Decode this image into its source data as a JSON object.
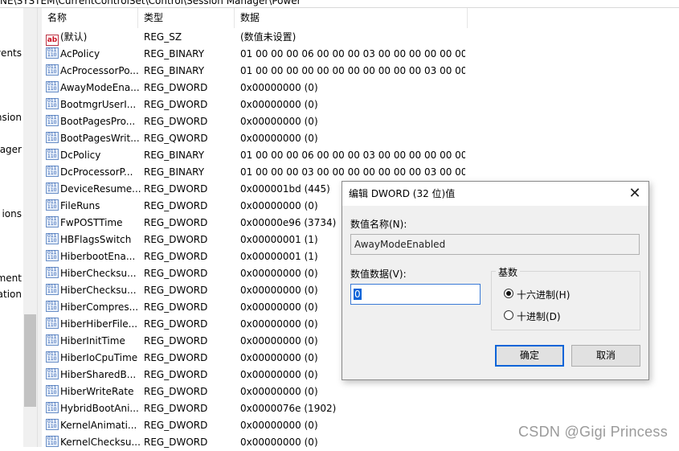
{
  "address": "NE\\SYSTEM\\CurrentControlSet\\Control\\Session Manager\\Power",
  "tree_items": [
    "vents",
    "nsion",
    "nager",
    "ions",
    "ment",
    "ation"
  ],
  "columns": {
    "name": "名称",
    "type": "类型",
    "data": "数据"
  },
  "rows": [
    {
      "icon": "string-icon",
      "name": "(默认)",
      "type": "REG_SZ",
      "data": "(数值未设置)"
    },
    {
      "icon": "binary-icon",
      "name": "AcPolicy",
      "type": "REG_BINARY",
      "data": "01 00 00 00 06 00 00 00 03 00 00 00 00 00 00..."
    },
    {
      "icon": "binary-icon",
      "name": "AcProcessorPo...",
      "type": "REG_BINARY",
      "data": "01 00 00 00 00 00 00 00 00 00 00 00 03 00 00..."
    },
    {
      "icon": "binary-icon",
      "name": "AwayModeEna...",
      "type": "REG_DWORD",
      "data": "0x00000000 (0)"
    },
    {
      "icon": "binary-icon",
      "name": "BootmgrUserI...",
      "type": "REG_DWORD",
      "data": "0x00000000 (0)"
    },
    {
      "icon": "binary-icon",
      "name": "BootPagesPro...",
      "type": "REG_DWORD",
      "data": "0x00000000 (0)"
    },
    {
      "icon": "binary-icon",
      "name": "BootPagesWrit...",
      "type": "REG_QWORD",
      "data": "0x00000000 (0)"
    },
    {
      "icon": "binary-icon",
      "name": "DcPolicy",
      "type": "REG_BINARY",
      "data": "01 00 00 00 06 00 00 00 03 00 00 00 00 00 00..."
    },
    {
      "icon": "binary-icon",
      "name": "DcProcessorP...",
      "type": "REG_BINARY",
      "data": "01 00 00 00 03 00 00 00 00 00 00 00 03 00 00..."
    },
    {
      "icon": "binary-icon",
      "name": "DeviceResume...",
      "type": "REG_DWORD",
      "data": "0x000001bd (445)"
    },
    {
      "icon": "binary-icon",
      "name": "FileRuns",
      "type": "REG_DWORD",
      "data": "0x00000000 (0)"
    },
    {
      "icon": "binary-icon",
      "name": "FwPOSTTime",
      "type": "REG_DWORD",
      "data": "0x00000e96 (3734)"
    },
    {
      "icon": "binary-icon",
      "name": "HBFlagsSwitch",
      "type": "REG_DWORD",
      "data": "0x00000001 (1)"
    },
    {
      "icon": "binary-icon",
      "name": "HiberbootEna...",
      "type": "REG_DWORD",
      "data": "0x00000001 (1)"
    },
    {
      "icon": "binary-icon",
      "name": "HiberChecksu...",
      "type": "REG_DWORD",
      "data": "0x00000000 (0)"
    },
    {
      "icon": "binary-icon",
      "name": "HiberChecksu...",
      "type": "REG_DWORD",
      "data": "0x00000000 (0)"
    },
    {
      "icon": "binary-icon",
      "name": "HiberCompres...",
      "type": "REG_DWORD",
      "data": "0x00000000 (0)"
    },
    {
      "icon": "binary-icon",
      "name": "HiberHiberFile...",
      "type": "REG_DWORD",
      "data": "0x00000000 (0)"
    },
    {
      "icon": "binary-icon",
      "name": "HiberInitTime",
      "type": "REG_DWORD",
      "data": "0x00000000 (0)"
    },
    {
      "icon": "binary-icon",
      "name": "HiberIoCpuTime",
      "type": "REG_DWORD",
      "data": "0x00000000 (0)"
    },
    {
      "icon": "binary-icon",
      "name": "HiberSharedB...",
      "type": "REG_DWORD",
      "data": "0x00000000 (0)"
    },
    {
      "icon": "binary-icon",
      "name": "HiberWriteRate",
      "type": "REG_DWORD",
      "data": "0x00000000 (0)"
    },
    {
      "icon": "binary-icon",
      "name": "HybridBootAni...",
      "type": "REG_DWORD",
      "data": "0x0000076e (1902)"
    },
    {
      "icon": "binary-icon",
      "name": "KernelAnimati...",
      "type": "REG_DWORD",
      "data": "0x00000000 (0)"
    },
    {
      "icon": "binary-icon",
      "name": "KernelChecksu...",
      "type": "REG_DWORD",
      "data": "0x00000000 (0)"
    }
  ],
  "dialog": {
    "title": "编辑 DWORD (32 位)值",
    "close_glyph": "✕",
    "name_label": "数值名称(N):",
    "name_value": "AwayModeEnabled",
    "data_label": "数值数据(V):",
    "data_value": "0",
    "base_label": "基数",
    "radio_hex": "十六进制(H)",
    "radio_dec": "十进制(D)",
    "selected_base": "hex",
    "ok_label": "确定",
    "cancel_label": "取消"
  },
  "watermark": "CSDN @Gigi Princess"
}
